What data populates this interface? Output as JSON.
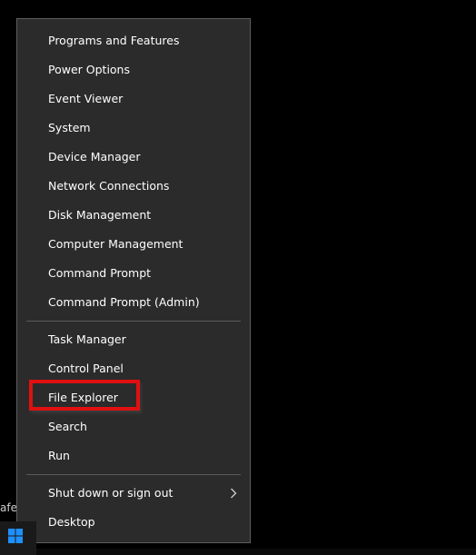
{
  "background": {
    "partial_text": "afe"
  },
  "menu": {
    "group1": [
      {
        "label": "Programs and Features"
      },
      {
        "label": "Power Options"
      },
      {
        "label": "Event Viewer"
      },
      {
        "label": "System"
      },
      {
        "label": "Device Manager"
      },
      {
        "label": "Network Connections"
      },
      {
        "label": "Disk Management"
      },
      {
        "label": "Computer Management"
      },
      {
        "label": "Command Prompt"
      },
      {
        "label": "Command Prompt (Admin)"
      }
    ],
    "group2": [
      {
        "label": "Task Manager"
      },
      {
        "label": "Control Panel"
      },
      {
        "label": "File Explorer"
      },
      {
        "label": "Search"
      },
      {
        "label": "Run"
      }
    ],
    "group3": [
      {
        "label": "Shut down or sign out",
        "submenu_icon": "chevron-right-icon"
      },
      {
        "label": "Desktop"
      }
    ]
  },
  "highlight": {
    "target": "File Explorer",
    "color": "#e01010"
  },
  "colors": {
    "menu_background": "#2b2b2b",
    "menu_border": "#5e5e5e",
    "menu_text": "#ffffff",
    "separator": "#5a5a5a",
    "start_icon": "#1e90ff"
  },
  "taskbar": {
    "start_icon": "windows-logo-icon"
  }
}
